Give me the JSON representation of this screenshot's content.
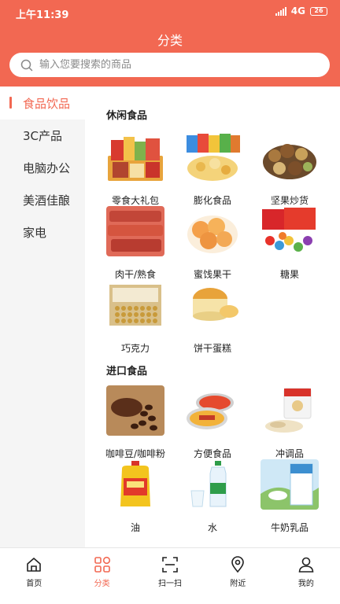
{
  "status": {
    "time": "上午11:39",
    "network": "4G",
    "battery": "26"
  },
  "title": "分类",
  "search": {
    "placeholder": "输入您要搜索的商品"
  },
  "sidebar": {
    "items": [
      {
        "label": "食品饮品",
        "active": true
      },
      {
        "label": "3C产品"
      },
      {
        "label": "电脑办公"
      },
      {
        "label": "美酒佳酿"
      },
      {
        "label": "家电"
      }
    ]
  },
  "sections": [
    {
      "title": "休闲食品",
      "products": [
        {
          "label": "零食大礼包",
          "icon": "snack-gift-pack-image"
        },
        {
          "label": "膨化食品",
          "icon": "puffed-food-image"
        },
        {
          "label": "坚果炒货",
          "icon": "nuts-image"
        },
        {
          "label": "肉干/熟食",
          "icon": "jerky-image"
        },
        {
          "label": "蜜饯果干",
          "icon": "dried-fruit-image"
        },
        {
          "label": "糖果",
          "icon": "candy-image"
        },
        {
          "label": "巧克力",
          "icon": "chocolate-image"
        },
        {
          "label": "饼干蛋糕",
          "icon": "cake-image"
        }
      ]
    },
    {
      "title": "进口食品",
      "products": [
        {
          "label": "咖啡豆/咖啡粉",
          "icon": "coffee-image"
        },
        {
          "label": "方便食品",
          "icon": "instant-food-image"
        },
        {
          "label": "冲调品",
          "icon": "oatmeal-image"
        },
        {
          "label": "油",
          "icon": "oil-image"
        },
        {
          "label": "水",
          "icon": "water-image"
        },
        {
          "label": "牛奶乳品",
          "icon": "milk-image"
        }
      ]
    }
  ],
  "tabbar": {
    "items": [
      {
        "label": "首页",
        "icon": "home-icon"
      },
      {
        "label": "分类",
        "icon": "category-icon",
        "active": true
      },
      {
        "label": "扫一扫",
        "icon": "scan-icon"
      },
      {
        "label": "附近",
        "icon": "location-icon"
      },
      {
        "label": "我的",
        "icon": "user-icon"
      }
    ]
  },
  "colors": {
    "accent": "#f26852",
    "sidebar_bg": "#f5f5f5"
  }
}
